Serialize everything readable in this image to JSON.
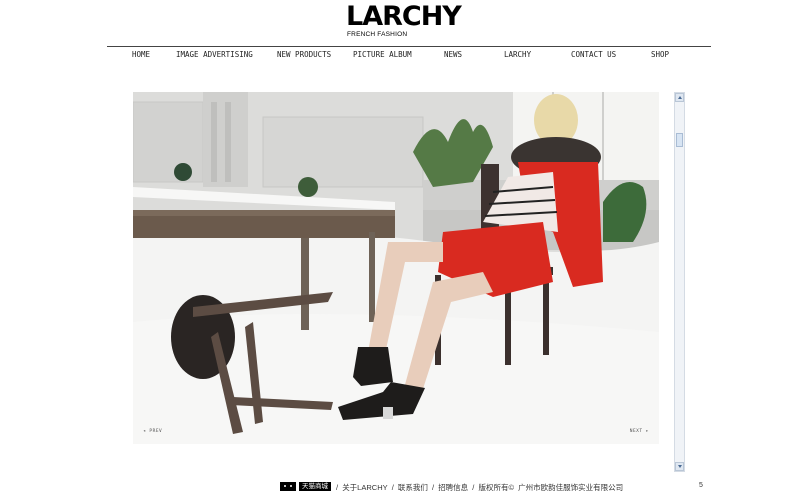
{
  "brand": {
    "logo_text": "LARCHY",
    "tagline": "FRENCH FASHION"
  },
  "nav": {
    "items": [
      {
        "label": "HOME"
      },
      {
        "label": "IMAGE ADVERTISING"
      },
      {
        "label": "NEW PRODUCTS"
      },
      {
        "label": "PICTURE ALBUM"
      },
      {
        "label": "NEWS"
      },
      {
        "label": "LARCHY"
      },
      {
        "label": "CONTACT US"
      },
      {
        "label": "SHOP"
      }
    ]
  },
  "hero": {
    "prev_label": "◂ PREV",
    "next_label": "NEXT ▸",
    "colors": {
      "coat": "#d92a20",
      "snow": "#f2f2f2",
      "table": "#6b5a4c"
    }
  },
  "footer": {
    "tmall_label": "天猫商城",
    "sep": "/",
    "about": "关于LARCHY",
    "contact": "联系我们",
    "jobs": "招聘信息",
    "copyright": "版权所有©",
    "company": "广州市欧韵佳服饰实业有限公司",
    "page_number": "5"
  }
}
